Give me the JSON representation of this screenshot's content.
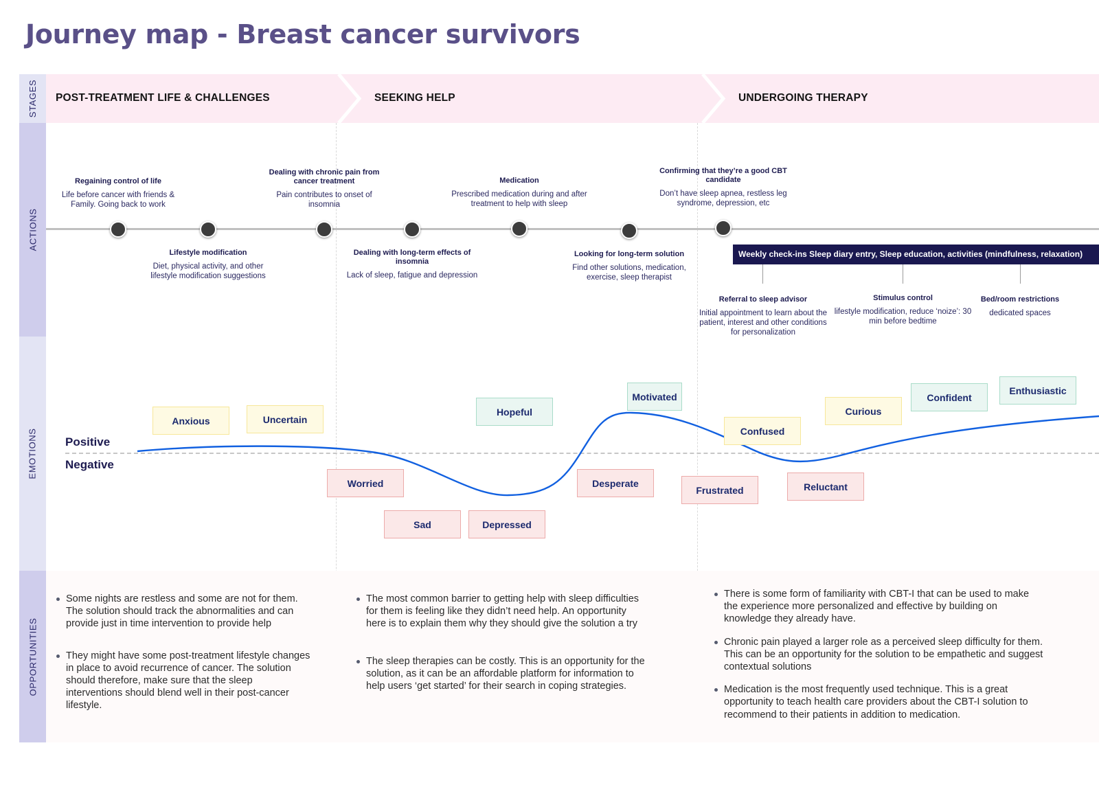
{
  "title": "Journey map - Breast cancer survivors",
  "row_labels": {
    "stages": "STAGES",
    "actions": "ACTIONS",
    "emotions": "EMOTIONS",
    "opportunities": "OPPORTUNITIES"
  },
  "stages": [
    {
      "label": "POST-TREATMENT LIFE & CHALLENGES"
    },
    {
      "label": "SEEKING HELP"
    },
    {
      "label": "UNDERGOING THERAPY"
    }
  ],
  "actions": [
    {
      "title": "Regaining control of life",
      "desc": "Life before cancer with friends & Family. Going back to work",
      "position": "above"
    },
    {
      "title": "Lifestyle modification",
      "desc": "Diet, physical activity, and other lifestyle modification suggestions",
      "position": "below"
    },
    {
      "title": "Dealing with chronic pain from cancer treatment",
      "desc": "Pain contributes to onset of insomnia",
      "position": "above"
    },
    {
      "title": "Dealing with long-term effects of insomnia",
      "desc": "Lack of sleep, fatigue and depression",
      "position": "below"
    },
    {
      "title": "Medication",
      "desc": "Prescribed medication during and after treatment to help with sleep",
      "position": "above"
    },
    {
      "title": "Looking for long-term solution",
      "desc": "Find other solutions, medication, exercise, sleep therapist",
      "position": "below"
    },
    {
      "title": "Confirming that they’re a good CBT candidate",
      "desc": "Don’t have sleep apnea, restless leg syndrome, depression, etc",
      "position": "above"
    }
  ],
  "therapy_bar": {
    "label": "Weekly check-ins Sleep diary entry, Sleep education, activities (mindfulness, relaxation)",
    "items": [
      {
        "title": "Referral to sleep advisor",
        "desc": "Initial appointment to learn about the patient, interest and other conditions for personalization"
      },
      {
        "title": "Stimulus control",
        "desc": "lifestyle modification, reduce ‘noize’: 30 min before bedtime"
      },
      {
        "title": "Bed/room restrictions",
        "desc": "dedicated spaces"
      }
    ]
  },
  "emotions": {
    "positive_label": "Positive",
    "negative_label": "Negative",
    "tags": [
      {
        "label": "Anxious",
        "tone": "neutral"
      },
      {
        "label": "Uncertain",
        "tone": "neutral"
      },
      {
        "label": "Worried",
        "tone": "negative"
      },
      {
        "label": "Sad",
        "tone": "negative"
      },
      {
        "label": "Depressed",
        "tone": "negative"
      },
      {
        "label": "Hopeful",
        "tone": "positive"
      },
      {
        "label": "Desperate",
        "tone": "negative"
      },
      {
        "label": "Motivated",
        "tone": "positive"
      },
      {
        "label": "Frustrated",
        "tone": "negative"
      },
      {
        "label": "Confused",
        "tone": "neutral"
      },
      {
        "label": "Reluctant",
        "tone": "negative"
      },
      {
        "label": "Curious",
        "tone": "neutral"
      },
      {
        "label": "Confident",
        "tone": "positive"
      },
      {
        "label": "Enthusiastic",
        "tone": "positive"
      }
    ],
    "curve_color": "#1160e0"
  },
  "opportunities": [
    {
      "items": [
        "Some nights are restless and some are not for them. The solution should track the abnormalities and can provide just in time intervention to provide help",
        "They might have some post-treatment lifestyle changes in place to avoid recurrence of cancer. The solution should therefore, make sure that the sleep interventions should blend well in their post-cancer lifestyle."
      ]
    },
    {
      "items": [
        "The most common barrier to getting help with sleep difficulties for them is feeling like they didn’t need help. An opportunity here is to explain them why they should give the solution a try",
        "The sleep therapies can be costly. This is an opportunity for the solution, as it can be an affordable platform for information to help users ‘get started’ for their search in coping strategies."
      ]
    },
    {
      "items": [
        "There is some form of familiarity with CBT-I that can be used to make the experience more personalized and effective by building on knowledge they already have.",
        "Chronic pain played a larger role as a perceived sleep difficulty for them. This can be an opportunity for the solution to be empathetic and suggest contextual solutions",
        "Medication is the most frequently used technique. This is a great opportunity to teach health care providers about the CBT-I solution to recommend to their patients in addition to medication."
      ]
    }
  ],
  "colors": {
    "title": "#5a5088",
    "stage_band": "#fdebf3",
    "therapy_bar": "#1a1850",
    "curve": "#1160e0"
  }
}
